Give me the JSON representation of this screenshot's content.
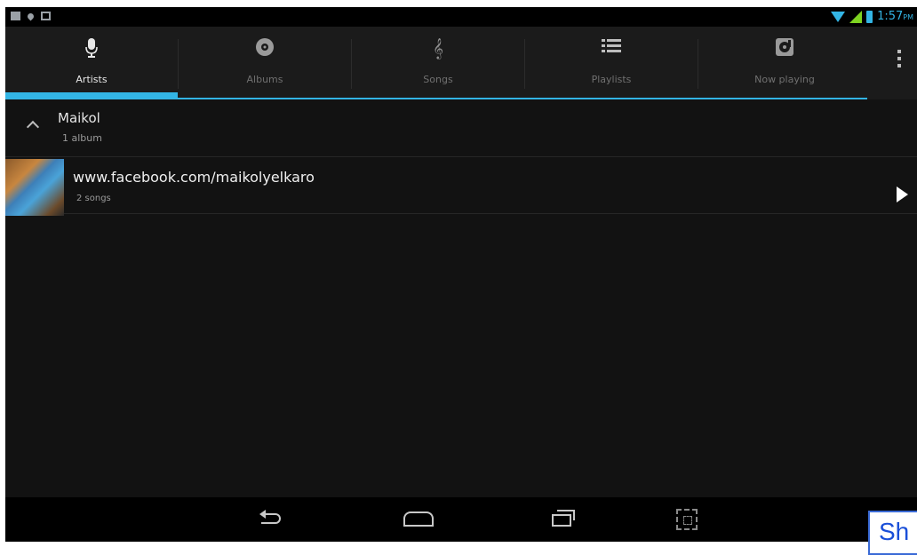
{
  "status_bar": {
    "time": "1:57",
    "ampm": "PM"
  },
  "tabs": [
    {
      "label": "Artists",
      "icon": "microphone-icon",
      "active": true
    },
    {
      "label": "Albums",
      "icon": "album-disc-icon",
      "active": false
    },
    {
      "label": "Songs",
      "icon": "music-note-icon",
      "active": false
    },
    {
      "label": "Playlists",
      "icon": "list-icon",
      "active": false
    },
    {
      "label": "Now playing",
      "icon": "now-playing-icon",
      "active": false
    }
  ],
  "accent_color": "#33b5e5",
  "group": {
    "title": "Maikol",
    "subtitle": "1 album"
  },
  "rows": [
    {
      "title": "www.facebook.com/maikolyelkaro",
      "subtitle": "2 songs"
    }
  ],
  "overlay_button": {
    "label": "Sh"
  }
}
